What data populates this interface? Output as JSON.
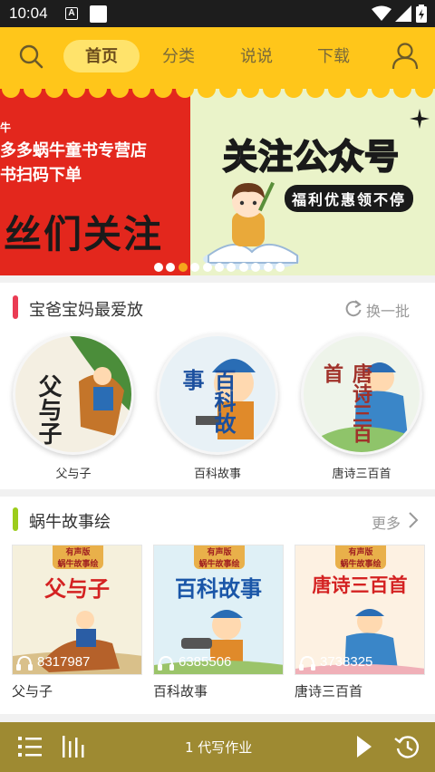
{
  "status_bar": {
    "time": "10:04",
    "notif_letter": "A"
  },
  "nav": {
    "tabs": [
      "首页",
      "分类",
      "说说",
      "下载"
    ],
    "active_tab": 0
  },
  "banner": {
    "left_line1": "多多蜗牛童书专营店",
    "left_line2": "书扫码下单",
    "left_big": "丝们关注",
    "left_top_fragment": "牛",
    "right_headline": "关注公众号",
    "right_sub": "福利优惠领不停",
    "dot_count": 11,
    "active_dot": 2
  },
  "section1": {
    "title": "宝爸宝妈最爱放",
    "refresh_label": "换一批",
    "items": [
      {
        "label": "父与子",
        "cover_text": "父与子"
      },
      {
        "label": "百科故事",
        "cover_text": "百科故事"
      },
      {
        "label": "唐诗三百首",
        "cover_text": "唐诗三百首"
      }
    ]
  },
  "section2": {
    "title": "蜗牛故事绘",
    "more_label": "更多",
    "badge_top": "有声版",
    "badge_sub": "蜗牛故事绘",
    "items": [
      {
        "label": "父与子",
        "cover_title": "父与子",
        "plays": "8317987"
      },
      {
        "label": "百科故事",
        "cover_title": "百科故事",
        "plays": "6385506"
      },
      {
        "label": "唐诗三百首",
        "cover_title": "唐诗三百首",
        "plays": "3738325"
      }
    ]
  },
  "player": {
    "title": "1 代写作业"
  },
  "colors": {
    "brand_yellow": "#ffc61a",
    "player_bg": "#9e8a32",
    "accent_red": "#e3271d",
    "accent_green": "#9ccc1c"
  }
}
